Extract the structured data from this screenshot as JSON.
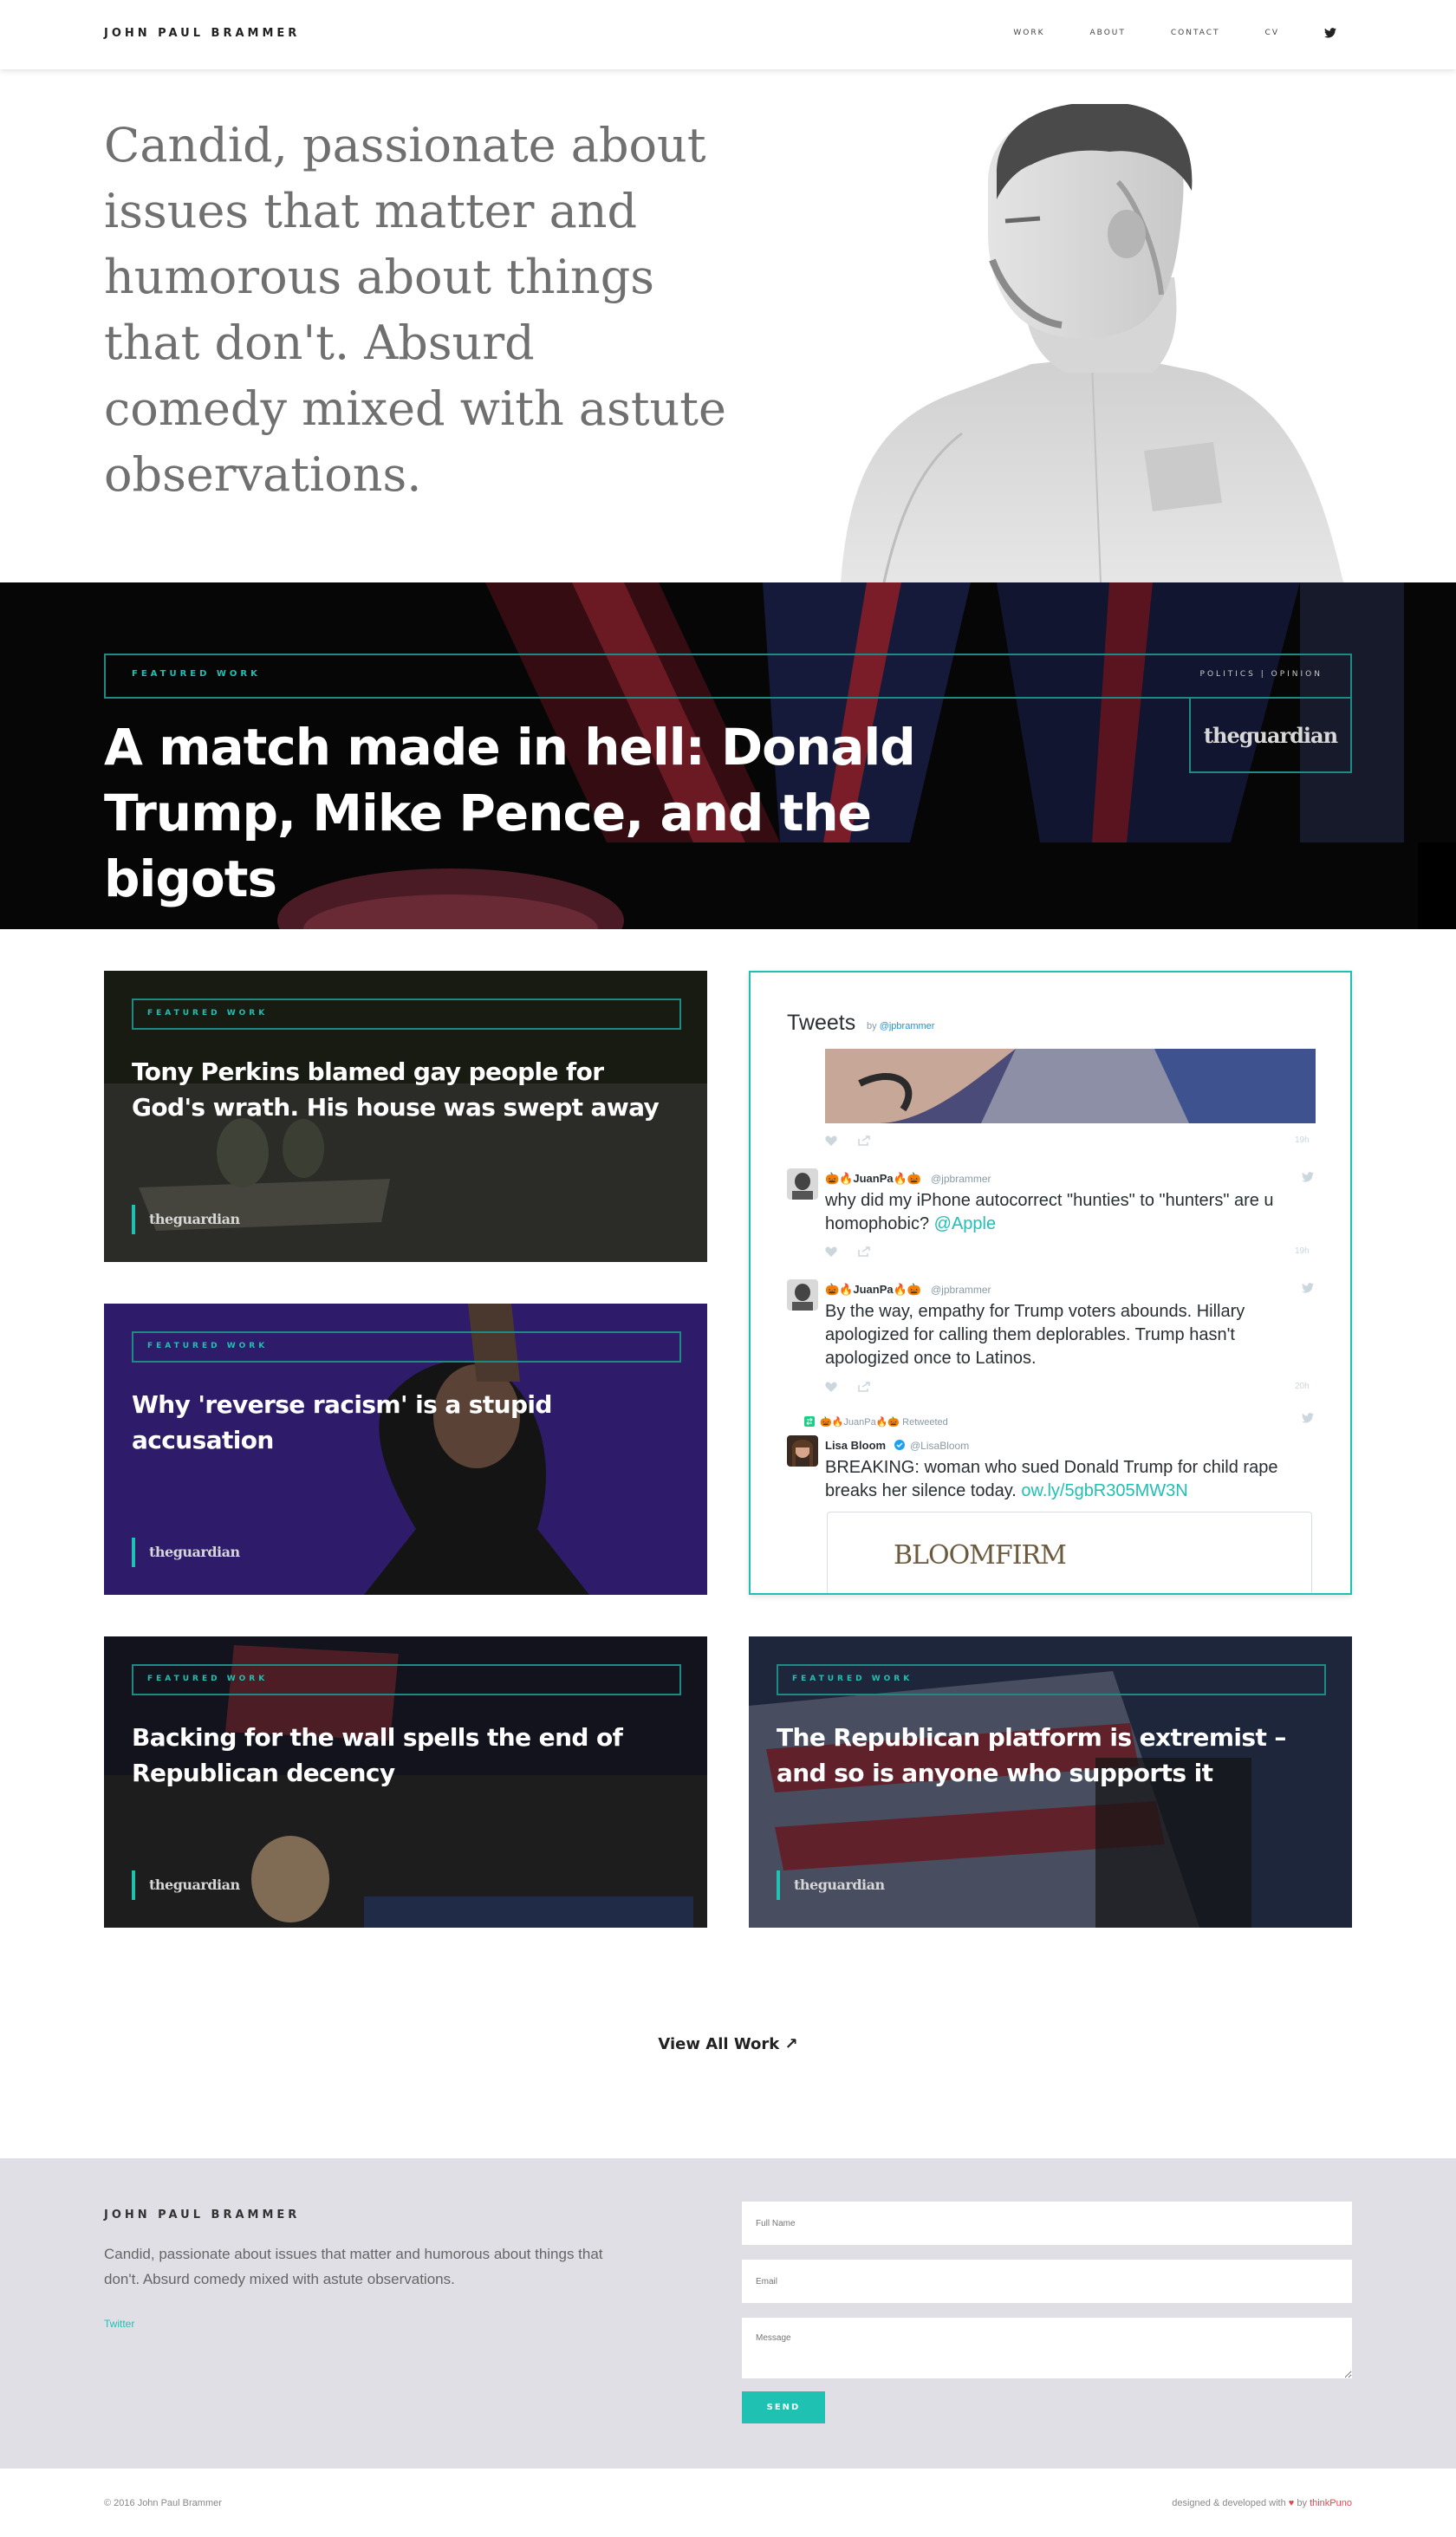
{
  "header": {
    "brand": "JOHN PAUL BRAMMER",
    "nav": [
      "WORK",
      "ABOUT",
      "CONTACT",
      "CV"
    ],
    "twitter_icon": "twitter-icon"
  },
  "hero": {
    "tagline": "Candid, passionate about issues that matter and humorous about things that don't. Absurd comedy mixed with astute observations."
  },
  "featured": {
    "label": "FEATURED WORK",
    "category": "POLITICS | OPINION",
    "publication": "theguardian",
    "title": "A match made in hell: Donald Trump, Mike Pence, and the bigots"
  },
  "cards": [
    {
      "label": "FEATURED WORK",
      "title": "Tony Perkins blamed gay people for God's wrath. His house was swept away",
      "publication": "theguardian"
    },
    {
      "label": "FEATURED WORK",
      "title": "Why 'reverse racism' is a stupid accusation",
      "publication": "theguardian"
    },
    {
      "label": "FEATURED WORK",
      "title": "Backing for the wall spells the end of Republican decency",
      "publication": "theguardian"
    },
    {
      "label": "FEATURED WORK",
      "title": "The Republican platform is extremist – and so is anyone who supports it",
      "publication": "theguardian"
    }
  ],
  "tweets": {
    "heading": "Tweets",
    "by": "by",
    "handle": "@jpbrammer",
    "items": [
      {
        "time": "19h"
      },
      {
        "name": "🎃🔥JuanPa🔥🎃",
        "handle": "@jpbrammer",
        "text": "why did my iPhone autocorrect \"hunties\" to \"hunters\" are u homophobic?",
        "link": "@Apple",
        "time": "19h"
      },
      {
        "name": "🎃🔥JuanPa🔥🎃",
        "handle": "@jpbrammer",
        "text": "By the way, empathy for Trump voters abounds. Hillary apologized for calling them deplorables. Trump hasn't apologized once to Latinos.",
        "time": "20h"
      },
      {
        "retweeted_by": "🎃🔥JuanPa🔥🎃 Retweeted",
        "name": "Lisa Bloom",
        "handle": "@LisaBloom",
        "text": "BREAKING: woman who sued Donald Trump for child rape breaks her silence today.",
        "link": "ow.ly/5gbR305MW3N",
        "card_title": "BLOOMFIRM"
      }
    ]
  },
  "view_all": "View All Work ↗",
  "footer": {
    "brand": "JOHN PAUL BRAMMER",
    "description": "Candid, passionate about issues that matter and humorous about things that don't. Absurd comedy mixed with astute observations.",
    "twitter": "Twitter",
    "fields": {
      "name": "Full Name",
      "email": "Email",
      "message": "Message"
    },
    "send": "SEND",
    "copyright": "© 2016 John Paul Brammer",
    "credit_pre": "designed & developed with",
    "credit_by": "by",
    "credit_maker": "thinkPuno"
  },
  "colors": {
    "accent": "#1fc1b2",
    "footer_bg": "#e0dfe6",
    "banner_bg": "#050505"
  }
}
